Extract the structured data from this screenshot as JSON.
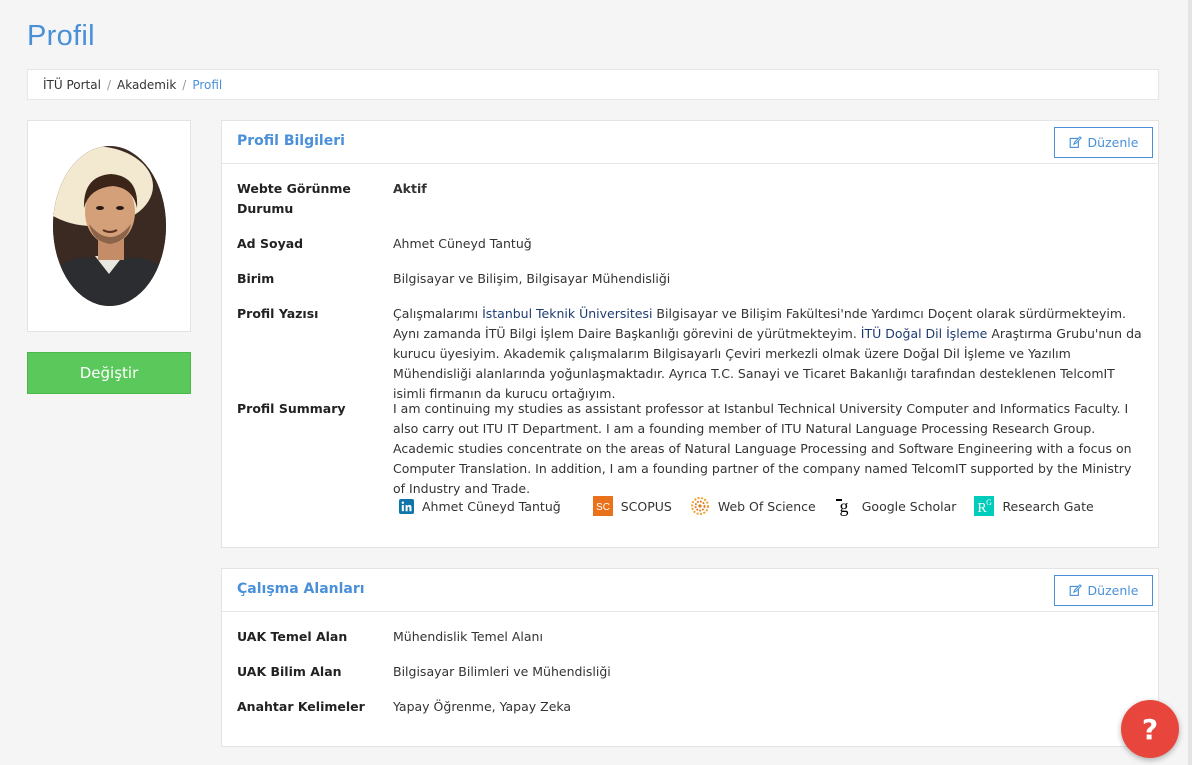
{
  "page": {
    "title": "Profil"
  },
  "breadcrumb": {
    "items": [
      "İTÜ Portal",
      "Akademik"
    ],
    "current": "Profil"
  },
  "photo": {
    "change_label": "Değiştir"
  },
  "profile_info": {
    "title": "Profil Bilgileri",
    "edit_label": "Düzenle",
    "fields": {
      "visibility_label_line1": "Webte Görünme",
      "visibility_label_line2": "Durumu",
      "visibility_value": "Aktif",
      "name_label": "Ad Soyad",
      "name_value": "Ahmet Cüneyd Tantuğ",
      "unit_label": "Birim",
      "unit_value": "Bilgisayar ve Bilişim, Bilgisayar Mühendisliği",
      "bio_label": "Profil Yazısı",
      "bio_part1": "Çalışmalarımı ",
      "bio_link1": "İstanbul Teknik Üniversitesi",
      "bio_part2": " Bilgisayar ve Bilişim Fakültesi'nde Yardımcı Doçent olarak sürdürmekteyim. Aynı zamanda İTÜ Bilgi İşlem Daire Başkanlığı görevini de yürütmekteyim. ",
      "bio_link2": "İTÜ Doğal Dil İşleme",
      "bio_part3": " Araştırma Grubu'nun da kurucu üyesiyim. Akademik çalışmalarım Bilgisayarlı Çeviri merkezli olmak üzere Doğal Dil İşleme ve Yazılım Mühendisliği alanlarında yoğunlaşmaktadır. Ayrıca T.C. Sanayi ve Ticaret Bakanlığı tarafından desteklenen TelcomIT isimli firmanın da kurucu ortağıyım.",
      "summary_label": "Profil Summary",
      "summary_value": "I am continuing my studies as assistant professor at Istanbul Technical University Computer and Informatics Faculty. I also carry out ITU IT Department. I am a founding member of ITU Natural Language Processing Research Group. Academic studies concentrate on the areas of Natural Language Processing and Software Engineering with a focus on Computer Translation. In addition, I am a founding partner of the company named TelcomIT supported by the Ministry of Industry and Trade."
    },
    "links": [
      {
        "label": "Ahmet Cüneyd Tantuğ",
        "icon": "linkedin-icon",
        "color": "#0e76a8"
      },
      {
        "label": "SCOPUS",
        "icon": "scopus-icon",
        "color": "#e9711c"
      },
      {
        "label": "Web Of Science",
        "icon": "web-of-science-icon",
        "color": "#f0a030"
      },
      {
        "label": "Google Scholar",
        "icon": "google-scholar-icon",
        "color": "#000000"
      },
      {
        "label": "Research Gate",
        "icon": "research-gate-icon",
        "color": "#00ccbb"
      }
    ]
  },
  "work_areas": {
    "title": "Çalışma Alanları",
    "edit_label": "Düzenle",
    "fields": {
      "basic_label": "UAK Temel Alan",
      "basic_value": "Mühendislik Temel Alanı",
      "science_label": "UAK Bilim Alan",
      "science_value": "Bilgisayar Bilimleri ve Mühendisliği",
      "keywords_label": "Anahtar Kelimeler",
      "keywords_value": "Yapay Öğrenme, Yapay Zeka"
    }
  },
  "help": {
    "label": "?",
    "color": "#e8453c"
  }
}
